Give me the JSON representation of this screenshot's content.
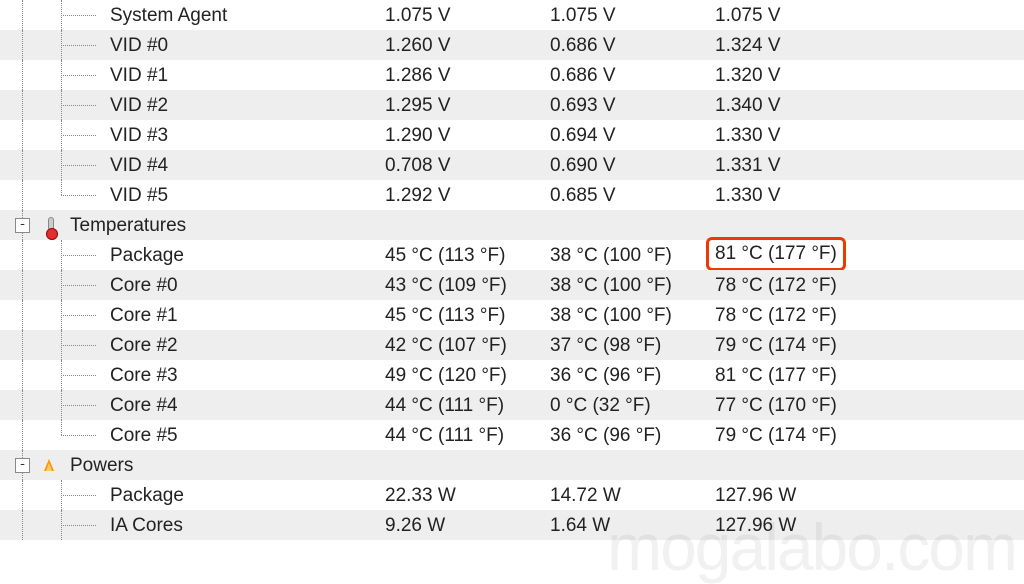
{
  "voltages": {
    "items": [
      {
        "name": "System Agent",
        "v1": "1.075 V",
        "v2": "1.075 V",
        "v3": "1.075 V"
      },
      {
        "name": "VID #0",
        "v1": "1.260 V",
        "v2": "0.686 V",
        "v3": "1.324 V"
      },
      {
        "name": "VID #1",
        "v1": "1.286 V",
        "v2": "0.686 V",
        "v3": "1.320 V"
      },
      {
        "name": "VID #2",
        "v1": "1.295 V",
        "v2": "0.693 V",
        "v3": "1.340 V"
      },
      {
        "name": "VID #3",
        "v1": "1.290 V",
        "v2": "0.694 V",
        "v3": "1.330 V"
      },
      {
        "name": "VID #4",
        "v1": "0.708 V",
        "v2": "0.690 V",
        "v3": "1.331 V"
      },
      {
        "name": "VID #5",
        "v1": "1.292 V",
        "v2": "0.685 V",
        "v3": "1.330 V"
      }
    ]
  },
  "temperatures": {
    "title": "Temperatures",
    "items": [
      {
        "name": "Package",
        "v1": "45 °C  (113 °F)",
        "v2": "38 °C  (100 °F)",
        "v3": "81 °C  (177 °F)",
        "hl": true
      },
      {
        "name": "Core #0",
        "v1": "43 °C  (109 °F)",
        "v2": "38 °C  (100 °F)",
        "v3": "78 °C  (172 °F)"
      },
      {
        "name": "Core #1",
        "v1": "45 °C  (113 °F)",
        "v2": "38 °C  (100 °F)",
        "v3": "78 °C  (172 °F)"
      },
      {
        "name": "Core #2",
        "v1": "42 °C  (107 °F)",
        "v2": "37 °C  (98 °F)",
        "v3": "79 °C  (174 °F)"
      },
      {
        "name": "Core #3",
        "v1": "49 °C  (120 °F)",
        "v2": "36 °C  (96 °F)",
        "v3": "81 °C  (177 °F)"
      },
      {
        "name": "Core #4",
        "v1": "44 °C  (111 °F)",
        "v2": "0 °C  (32 °F)",
        "v3": "77 °C  (170 °F)"
      },
      {
        "name": "Core #5",
        "v1": "44 °C  (111 °F)",
        "v2": "36 °C  (96 °F)",
        "v3": "79 °C  (174 °F)"
      }
    ]
  },
  "powers": {
    "title": "Powers",
    "items": [
      {
        "name": "Package",
        "v1": "22.33 W",
        "v2": "14.72 W",
        "v3": "127.96 W"
      },
      {
        "name": "IA Cores",
        "v1": "9.26 W",
        "v2": "1.64 W",
        "v3": "127.96 W"
      }
    ]
  },
  "watermark": "mogalabo.com",
  "expander_glyph": "-"
}
